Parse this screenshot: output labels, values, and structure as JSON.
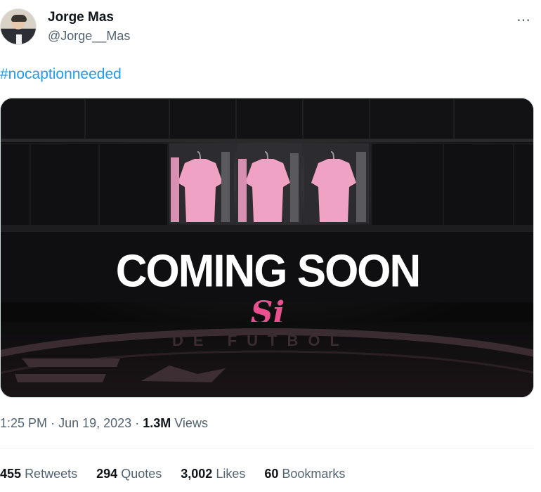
{
  "author": {
    "name": "Jorge Mas",
    "handle": "@Jorge__Mas"
  },
  "tweet": {
    "text": "#nocaptionneeded",
    "more_icon": "⋯"
  },
  "media": {
    "headline": "COMING SOON",
    "logo_text": "Si",
    "floor_text": "DE FUTBOL"
  },
  "meta": {
    "time": "1:25 PM",
    "date": "Jun 19, 2023",
    "separator": "·",
    "views_count": "1.3M",
    "views_label": "Views"
  },
  "stats": [
    {
      "count": "455",
      "label": "Retweets"
    },
    {
      "count": "294",
      "label": "Quotes"
    },
    {
      "count": "3,002",
      "label": "Likes"
    },
    {
      "count": "60",
      "label": "Bookmarks"
    }
  ],
  "colors": {
    "link": "#1d9bf0",
    "secondary_text": "#536471",
    "jersey_pink": "#f4a6c8",
    "logo_pink": "#e8508f"
  }
}
